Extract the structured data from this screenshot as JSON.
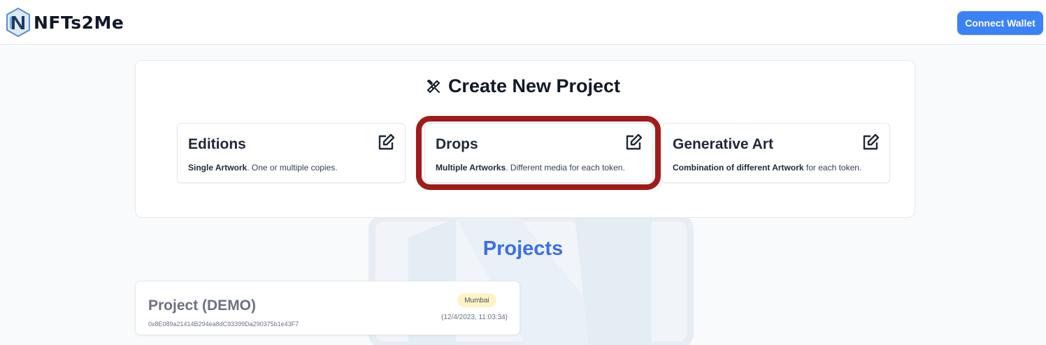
{
  "header": {
    "logo_text": "NFTs2Me",
    "connect_wallet_label": "Connect Wallet"
  },
  "create_project": {
    "title": "Create New Project",
    "icon": "tools-icon",
    "options": [
      {
        "title": "Editions",
        "desc_bold": "Single Artwork",
        "desc_rest": ". One or multiple copies.",
        "icon": "edit-icon"
      },
      {
        "title": "Drops",
        "desc_bold": "Multiple Artworks",
        "desc_rest": ". Different media for each token.",
        "icon": "edit-icon"
      },
      {
        "title": "Generative Art",
        "desc_bold": "Combination of different Artwork",
        "desc_rest": " for each token.",
        "icon": "edit-icon"
      }
    ]
  },
  "projects": {
    "heading": "Projects",
    "items": [
      {
        "name": "Project (DEMO)",
        "address": "0x8E089a21414B294ea8dC93399Da290375b1e43F7",
        "network": "Mumbai",
        "date": "(12/4/2023, 11:03:34)"
      }
    ]
  },
  "colors": {
    "accent": "#3b82f6",
    "projects_heading": "#3b6fe6",
    "highlight_ring": "#a11b1b",
    "badge_bg": "#fef3c7"
  }
}
